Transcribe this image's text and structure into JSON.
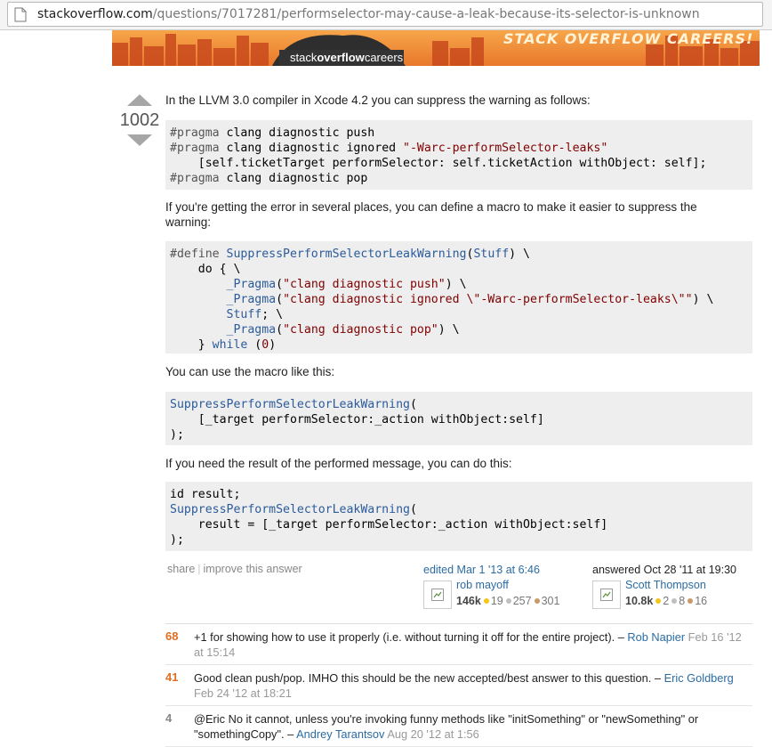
{
  "browser": {
    "url_host": "stackoverflow.com",
    "url_path": "/questions/7017281/performselector-may-cause-a-leak-because-its-selector-is-unknown"
  },
  "banner": {
    "logo_prefix": "stack",
    "logo_bold": "overflow",
    "logo_suffix": "careers",
    "tagline": "STACK OVERFLOW CAREERS!"
  },
  "answer": {
    "vote_count": "1002",
    "paragraph_1": "In the LLVM 3.0 compiler in Xcode 4.2 you can suppress the warning as follows:",
    "code_1": [
      "#pragma clang diagnostic push",
      "#pragma clang diagnostic ignored \"-Warc-performSelector-leaks\"",
      "    [self.ticketTarget performSelector: self.ticketAction withObject: self];",
      "#pragma clang diagnostic pop"
    ],
    "paragraph_2": "If you're getting the error in several places, you can define a macro to make it easier to suppress the warning:",
    "code_2": [
      "#define SuppressPerformSelectorLeakWarning(Stuff) \\",
      "    do { \\",
      "        _Pragma(\"clang diagnostic push\") \\",
      "        _Pragma(\"clang diagnostic ignored \\\"-Warc-performSelector-leaks\\\"\") \\",
      "        Stuff; \\",
      "        _Pragma(\"clang diagnostic pop\") \\",
      "    } while (0)"
    ],
    "paragraph_3": "You can use the macro like this:",
    "code_3": [
      "SuppressPerformSelectorLeakWarning(",
      "    [_target performSelector:_action withObject:self]",
      ");"
    ],
    "paragraph_4": "If you need the result of the performed message, you can do this:",
    "code_4": [
      "id result;",
      "SuppressPerformSelectorLeakWarning(",
      "    result = [_target performSelector:_action withObject:self]",
      ");"
    ]
  },
  "post_menu": {
    "share": "share",
    "improve": "improve this answer"
  },
  "edited": {
    "action": "edited Mar 1 '13 at 6:46",
    "user": "rob mayoff",
    "reputation": "146k",
    "gold": "19",
    "silver": "257",
    "bronze": "301"
  },
  "answered": {
    "action": "answered Oct 28 '11 at 19:30",
    "user": "Scott Thompson",
    "reputation": "10.8k",
    "gold": "2",
    "silver": "8",
    "bronze": "16"
  },
  "comments": [
    {
      "score": "68",
      "text": "+1 for showing how to use it properly (i.e. without turning it off for the entire project). –",
      "user": "Rob Napier",
      "date": "Feb 16 '12 at 15:14"
    },
    {
      "score": "41",
      "text": "Good clean push/pop. IMHO this should be the new accepted/best answer to this question. –",
      "user": "Eric Goldberg",
      "date": "Feb 24 '12 at 18:21"
    },
    {
      "score": "4",
      "text": "@Eric No it cannot, unless you're invoking funny methods like \"initSomething\" or \"newSomething\" or \"somethingCopy\". –",
      "user": "Andrey Tarantsov",
      "date": "Aug 20 '12 at 1:56"
    }
  ],
  "colors": {
    "link": "#2b6ca3",
    "hot_score": "#e06d20",
    "code_background": "#eeeeee",
    "banner_orange": "#e8782c"
  }
}
